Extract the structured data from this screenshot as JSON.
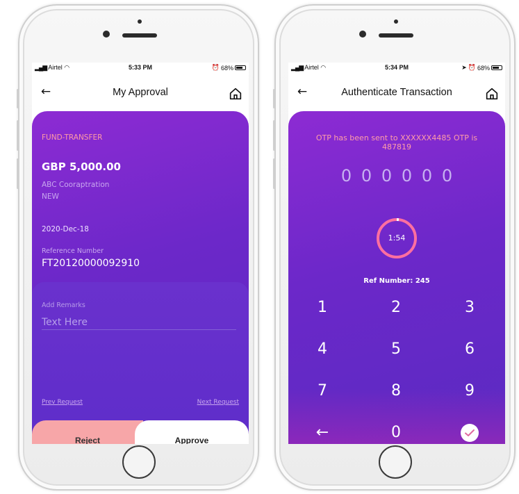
{
  "theme": {
    "accent_purple": "#6c28c9",
    "accent_pink": "#ff9aa5",
    "reject_color": "#f7a6a8",
    "timer_ring": "#ff6fa0"
  },
  "left_screen": {
    "status": {
      "carrier": "Airtel",
      "time": "5:33 PM",
      "battery": "68%"
    },
    "appbar": {
      "title": "My Approval"
    },
    "transfer": {
      "type": "FUND-TRANSFER",
      "amount": "GBP 5,000.00",
      "company": "ABC Cooraptration",
      "status": "NEW",
      "date": "2020-Dec-18",
      "ref_label": "Reference Number",
      "ref_value": "FT20120000092910"
    },
    "remarks": {
      "label": "Add Remarks",
      "placeholder": "Text Here"
    },
    "nav": {
      "prev": "Prev Request",
      "next": "Next Request"
    },
    "actions": {
      "reject": "Reject",
      "approve": "Approve"
    }
  },
  "right_screen": {
    "status": {
      "carrier": "Airtel",
      "time": "5:34 PM",
      "battery": "68%"
    },
    "appbar": {
      "title": "Authenticate Transaction"
    },
    "otp_message": "OTP has been sent to XXXXXX4485 OTP is 487819",
    "otp_digits": [
      "0",
      "0",
      "0",
      "0",
      "0",
      "0"
    ],
    "timer": "1:54",
    "ref_number": "Ref Number:  245",
    "keypad": [
      "1",
      "2",
      "3",
      "4",
      "5",
      "6",
      "7",
      "8",
      "9",
      "←",
      "0",
      "✓"
    ]
  }
}
